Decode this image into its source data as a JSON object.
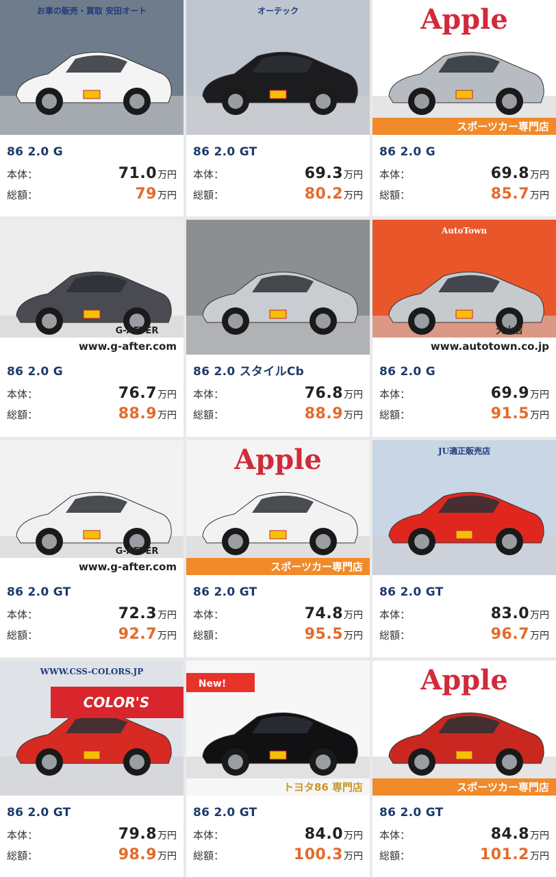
{
  "labels": {
    "body": "本体：",
    "total": "総額：",
    "unit": "万円"
  },
  "listings": [
    {
      "model": "86 2.0 G",
      "body_price": "71.0",
      "total_price": "79",
      "photo": {
        "bg": "#6f7c8b",
        "car": "#f4f4f4",
        "banner": "",
        "banner_bg": "",
        "banner_fg": "",
        "overlay": "",
        "overlay_bg": "",
        "overlay_fg": "",
        "tag": "",
        "top_text": "お車の販売・買取 安田オート"
      }
    },
    {
      "model": "86 2.0 GT",
      "body_price": "69.3",
      "total_price": "80.2",
      "photo": {
        "bg": "#bfc6cf",
        "car": "#1c1c1e",
        "banner": "",
        "banner_bg": "",
        "banner_fg": "",
        "overlay": "",
        "overlay_bg": "",
        "overlay_fg": "",
        "tag": "",
        "top_text": "オーテック"
      }
    },
    {
      "model": "86 2.0 G",
      "body_price": "69.8",
      "total_price": "85.7",
      "photo": {
        "bg": "#ffffff",
        "car": "#b7bcc3",
        "banner": "スポーツカー専門店",
        "banner_bg": "#f08a2a",
        "banner_fg": "#ffffff",
        "overlay": "",
        "overlay_bg": "",
        "overlay_fg": "",
        "tag": "",
        "top_text": "Apple"
      }
    },
    {
      "model": "86 2.0 G",
      "body_price": "76.7",
      "total_price": "88.9",
      "photo": {
        "bg": "#ededed",
        "car": "#4a4a52",
        "banner": "www.g-after.com",
        "banner_bg": "#ffffff",
        "banner_fg": "#222222",
        "overlay": "G-AFTER",
        "overlay_bg": "",
        "overlay_fg": "#222222",
        "tag": "",
        "top_text": ""
      }
    },
    {
      "model": "86 2.0 スタイルCb",
      "body_price": "76.8",
      "total_price": "88.9",
      "photo": {
        "bg": "#8c8f92",
        "car": "#c9ccd0",
        "banner": "",
        "banner_bg": "",
        "banner_fg": "",
        "overlay": "",
        "overlay_bg": "",
        "overlay_fg": "",
        "tag": "",
        "top_text": ""
      }
    },
    {
      "model": "86 2.0 G",
      "body_price": "69.9",
      "total_price": "91.5",
      "photo": {
        "bg": "#e8562a",
        "car": "#c7cacd",
        "banner": "www.autotown.co.jp",
        "banner_bg": "#ffffff",
        "banner_fg": "#222222",
        "overlay": "犬山店",
        "overlay_bg": "",
        "overlay_fg": "#222222",
        "tag": "",
        "top_text": "AutoTown"
      }
    },
    {
      "model": "86 2.0 GT",
      "body_price": "72.3",
      "total_price": "92.7",
      "photo": {
        "bg": "#f2f2f2",
        "car": "#f0f0f0",
        "banner": "www.g-after.com",
        "banner_bg": "#ffffff",
        "banner_fg": "#222222",
        "overlay": "G-AFTER",
        "overlay_bg": "",
        "overlay_fg": "#222222",
        "tag": "",
        "top_text": ""
      }
    },
    {
      "model": "86 2.0 GT",
      "body_price": "74.8",
      "total_price": "95.5",
      "photo": {
        "bg": "#f4f4f4",
        "car": "#f2f2f2",
        "banner": "スポーツカー専門店",
        "banner_bg": "#f08a2a",
        "banner_fg": "#ffffff",
        "overlay": "",
        "overlay_bg": "",
        "overlay_fg": "",
        "tag": "",
        "top_text": "Apple"
      }
    },
    {
      "model": "86 2.0 GT",
      "body_price": "83.0",
      "total_price": "96.7",
      "photo": {
        "bg": "#c9d6e6",
        "car": "#e0271f",
        "banner": "",
        "banner_bg": "",
        "banner_fg": "",
        "overlay": "",
        "overlay_bg": "",
        "overlay_fg": "",
        "tag": "",
        "top_text": "JU適正販売店"
      }
    },
    {
      "model": "86 2.0 GT",
      "body_price": "79.8",
      "total_price": "98.9",
      "photo": {
        "bg": "#dfe3e8",
        "car": "#d62a23",
        "banner": "",
        "banner_bg": "",
        "banner_fg": "",
        "overlay": "COLOR'S",
        "overlay_bg": "#d8262c",
        "overlay_fg": "#ffffff",
        "tag": "",
        "top_text": "WWW.CSS-COLORS.JP"
      }
    },
    {
      "model": "86 2.0 GT",
      "body_price": "84.0",
      "total_price": "100.3",
      "photo": {
        "bg": "#f7f7f7",
        "car": "#111114",
        "banner": "トヨタ86 専門店",
        "banner_bg": "#f6f6f6",
        "banner_fg": "#c9962a",
        "overlay": "",
        "overlay_bg": "",
        "overlay_fg": "",
        "tag": "New!",
        "top_text": ""
      }
    },
    {
      "model": "86 2.0 GT",
      "body_price": "84.8",
      "total_price": "101.2",
      "photo": {
        "bg": "#ffffff",
        "car": "#c8281f",
        "banner": "スポーツカー専門店",
        "banner_bg": "#f08a2a",
        "banner_fg": "#ffffff",
        "overlay": "",
        "overlay_bg": "",
        "overlay_fg": "",
        "tag": "",
        "top_text": "Apple"
      }
    }
  ]
}
